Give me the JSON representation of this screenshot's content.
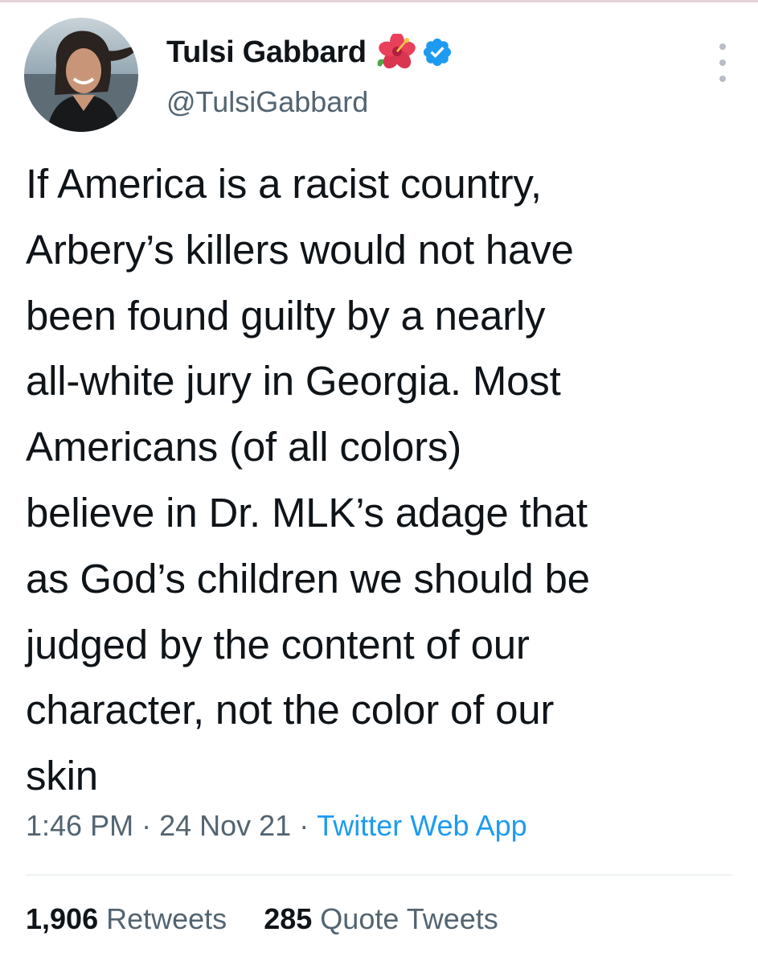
{
  "tweet": {
    "author": {
      "display_name": "Tulsi Gabbard",
      "handle": "@TulsiGabbard",
      "avatar_icon": "profile-photo",
      "name_emoji": "hibiscus-icon",
      "verified_icon": "verified-badge-icon"
    },
    "text": "If America is a racist country,\nArbery’s killers would not have\nbeen found guilty by a nearly\nall-white jury in Georgia. Most\nAmericans (of all colors)\nbelieve in Dr. MLK’s adage that\nas God’s children we should be\njudged by the content of our\ncharacter, not the color of our\nskin",
    "time": "1:46 PM",
    "date": "24 Nov 21",
    "separator": "·",
    "source": "Twitter Web App",
    "stats": {
      "retweets_count": "1,906",
      "retweets_label": "Retweets",
      "quotes_count": "285",
      "quotes_label": "Quote Tweets"
    }
  },
  "colors": {
    "text": "#0f1419",
    "secondary": "#536471",
    "link": "#1d9bf0",
    "verified": "#1d9bf0",
    "divider": "#eff3f4"
  }
}
